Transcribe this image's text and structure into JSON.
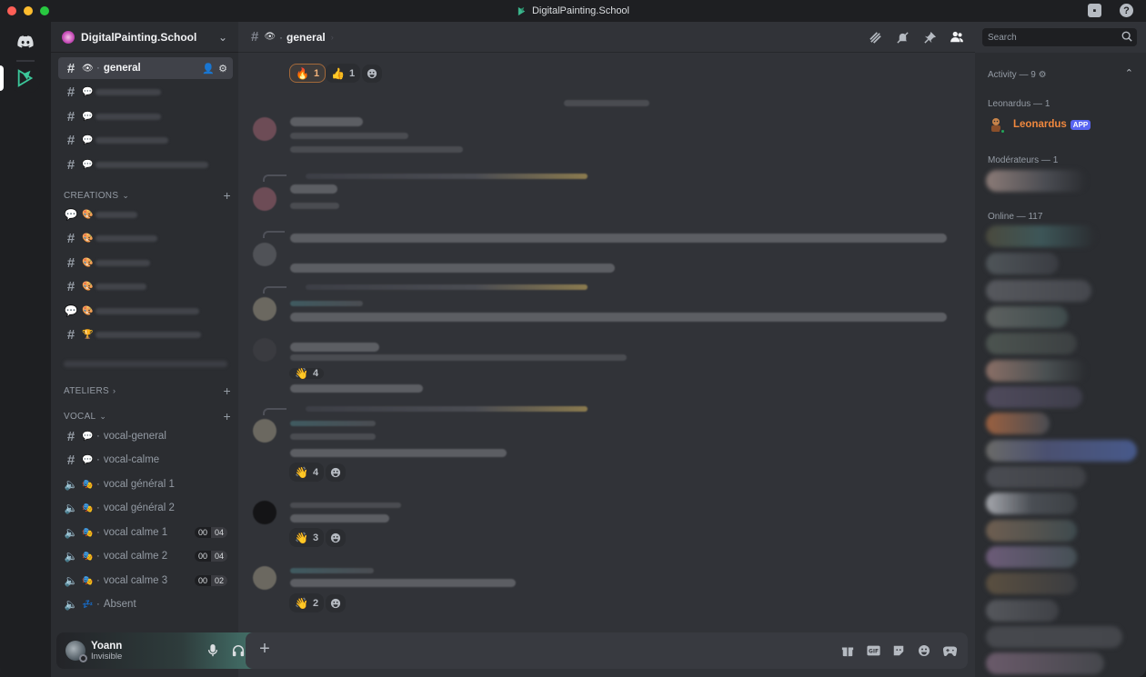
{
  "window": {
    "title": "DigitalPainting.School"
  },
  "server": {
    "name": "DigitalPainting.School"
  },
  "channels": {
    "top": [
      {
        "type": "text",
        "emoji": "👁",
        "label": "general",
        "active": true
      }
    ],
    "categories": {
      "creations": "CREATIONS",
      "ateliers": "ATELIERS",
      "vocal": "VOCAL"
    },
    "vocal": [
      {
        "kind": "text",
        "emoji": "💬",
        "label": "vocal-general"
      },
      {
        "kind": "text",
        "emoji": "💬",
        "label": "vocal-calme"
      },
      {
        "kind": "voice",
        "emoji": "🎭",
        "label": "vocal général 1"
      },
      {
        "kind": "voice",
        "emoji": "🎭",
        "label": "vocal général 2"
      },
      {
        "kind": "voice",
        "emoji": "🎭",
        "label": "vocal calme 1",
        "counts": [
          "00",
          "04"
        ]
      },
      {
        "kind": "voice",
        "emoji": "🎭",
        "label": "vocal calme 2",
        "counts": [
          "00",
          "04"
        ]
      },
      {
        "kind": "voice",
        "emoji": "🎭",
        "label": "vocal calme 3",
        "counts": [
          "00",
          "02"
        ]
      },
      {
        "kind": "voice",
        "emoji": "💤",
        "label": "Absent"
      }
    ]
  },
  "user": {
    "name": "Yoann",
    "status": "Invisible"
  },
  "chat_header": {
    "channel": "general"
  },
  "search": {
    "placeholder": "Search"
  },
  "reactions": {
    "top": [
      {
        "emoji": "🔥",
        "count": "1",
        "mine": true
      },
      {
        "emoji": "👍",
        "count": "1"
      }
    ],
    "r1": {
      "emoji": "👋",
      "count": "4"
    },
    "r2": {
      "emoji": "👋",
      "count": "4"
    },
    "r3": {
      "emoji": "👋",
      "count": "3"
    },
    "r4": {
      "emoji": "👋",
      "count": "2"
    }
  },
  "members": {
    "activity": "Activity — 9",
    "leonardus_group": "Leonardus — 1",
    "leonardus_name": "Leonardus",
    "app_badge": "APP",
    "moderators": "Modérateurs — 1",
    "online": "Online — 117"
  },
  "colors": {
    "accent": "#5865f2",
    "leonardus": "#f0883e",
    "online": "#23a55a"
  }
}
